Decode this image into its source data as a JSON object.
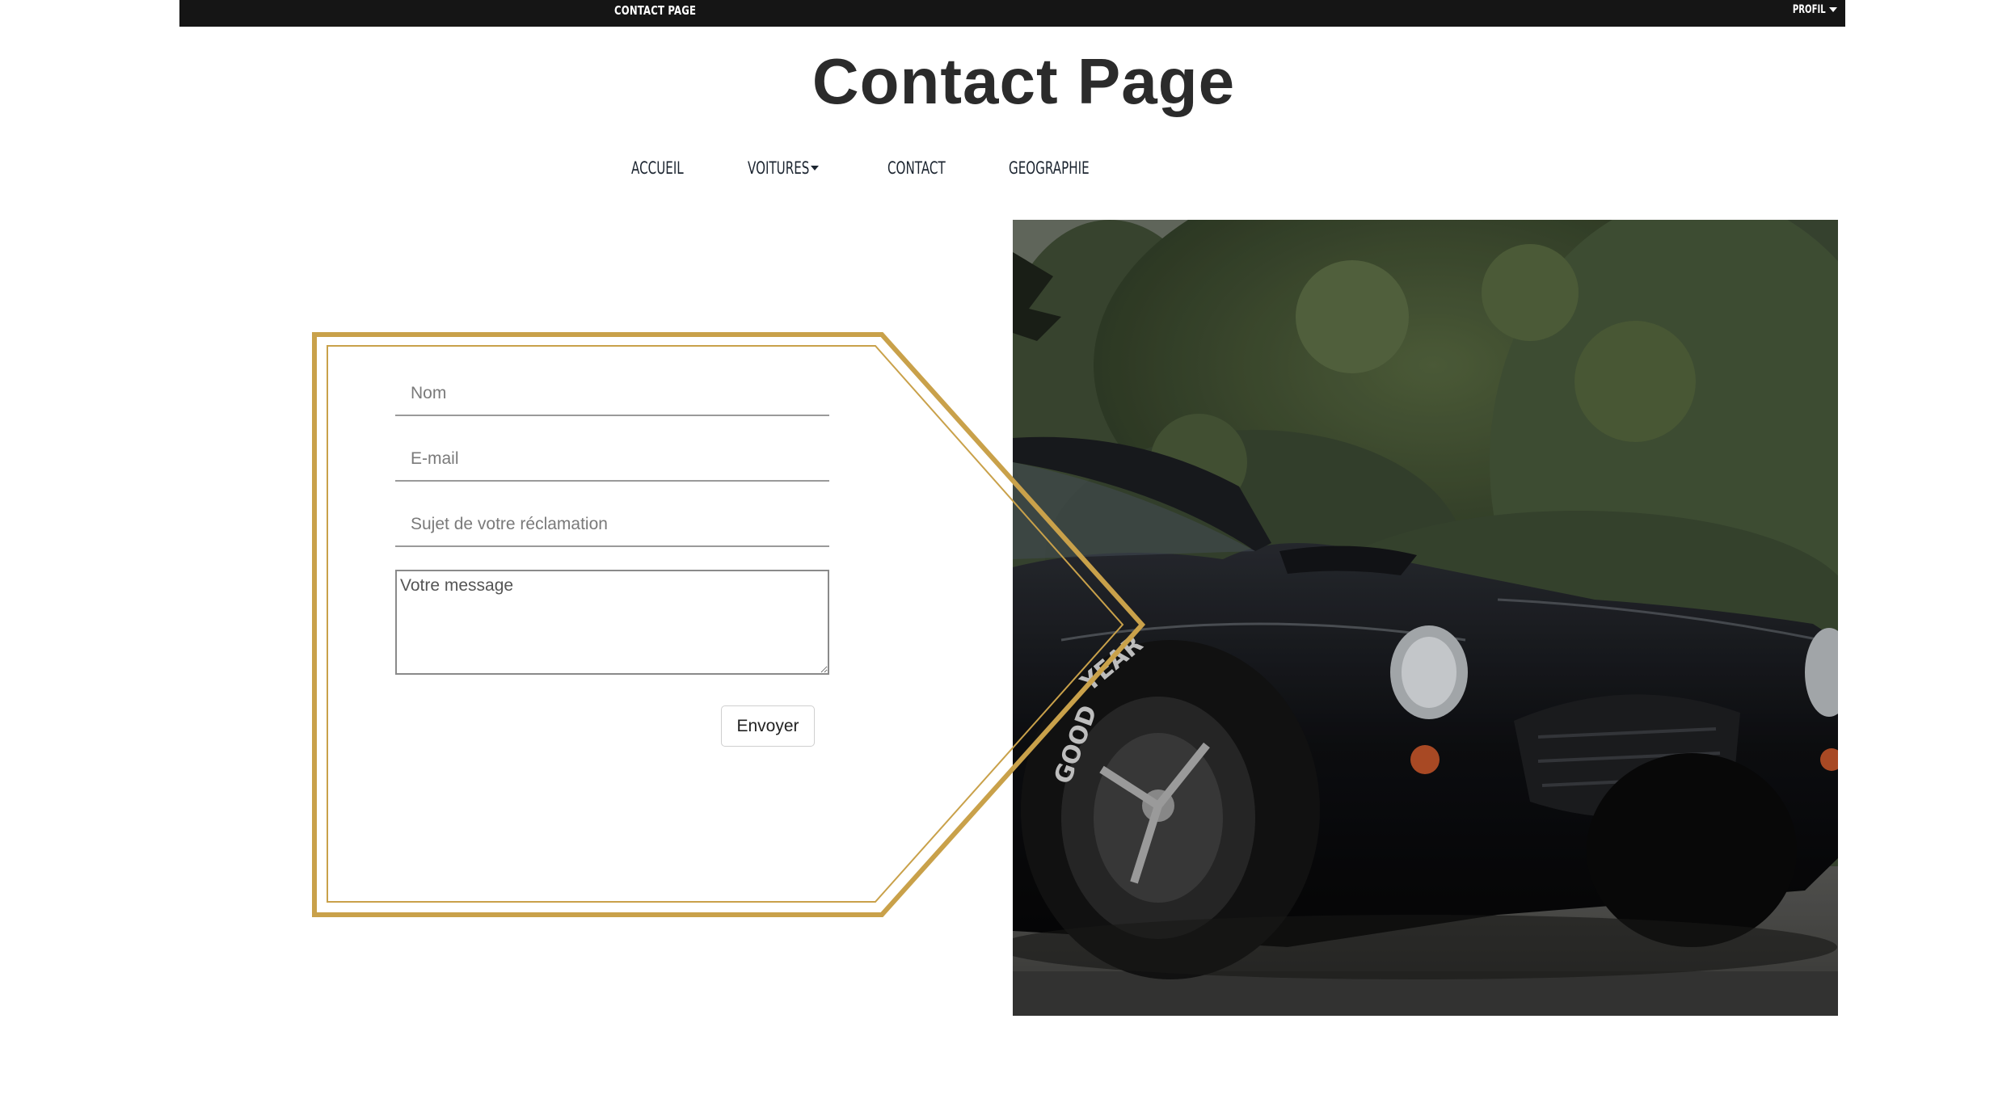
{
  "topbar": {
    "title": "CONTACT PAGE",
    "profile_label": "PROFIL"
  },
  "heading": "Contact Page",
  "nav": {
    "items": [
      {
        "label": "ACCUEIL"
      },
      {
        "label": "VOITURES",
        "has_dropdown": true
      },
      {
        "label": "CONTACT"
      },
      {
        "label": "GEOGRAPHIE"
      }
    ]
  },
  "form": {
    "name_placeholder": "Nom",
    "email_placeholder": "E-mail",
    "subject_placeholder": "Sujet de votre réclamation",
    "message_placeholder": "Votre message",
    "submit_label": "Envoyer"
  },
  "colors": {
    "topbar_bg": "#151515",
    "frame_gold": "#c9a14a",
    "heading": "#2b2b2b"
  },
  "image": {
    "subject": "black-classic-roadster-car-photo"
  }
}
